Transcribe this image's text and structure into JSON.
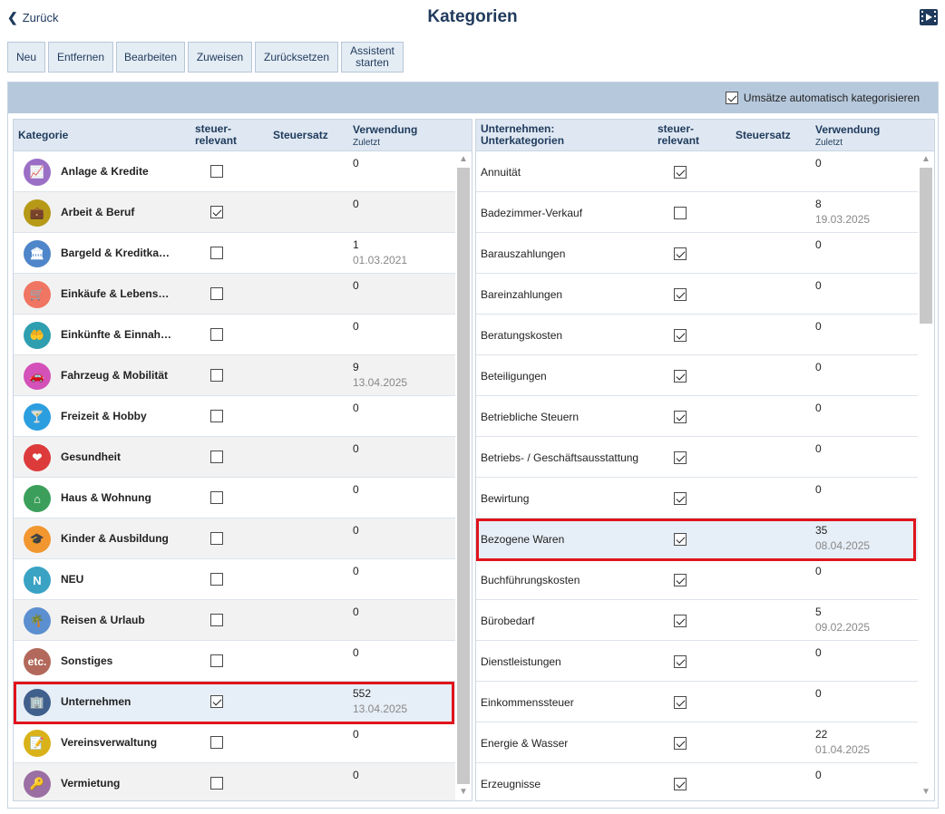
{
  "header": {
    "back_label": "Zurück",
    "title": "Kategorien"
  },
  "toolbar": {
    "new": "Neu",
    "remove": "Entfernen",
    "edit": "Bearbeiten",
    "assign": "Zuweisen",
    "reset": "Zurücksetzen",
    "wizard_1": "Assistent",
    "wizard_2": "starten"
  },
  "auto_categorize": {
    "label": "Umsätze automatisch kategorisieren",
    "checked": true
  },
  "left": {
    "col_category": "Kategorie",
    "col_tax_1": "steuer-",
    "col_tax_2": "relevant",
    "col_rate": "Steuersatz",
    "col_usage": "Verwendung",
    "col_last": "Zuletzt",
    "rows": [
      {
        "name": "Anlage & Kredite",
        "tax": false,
        "count": "0",
        "date": "",
        "icon": "chart-icon",
        "glyph": "📈",
        "color": "#9b6fc6"
      },
      {
        "name": "Arbeit & Beruf",
        "tax": true,
        "count": "0",
        "date": "",
        "icon": "briefcase-icon",
        "glyph": "💼",
        "color": "#b69a17"
      },
      {
        "name": "Bargeld & Kreditka…",
        "tax": false,
        "count": "1",
        "date": "01.03.2021",
        "icon": "bank-icon",
        "glyph": "🏛",
        "color": "#4f85c9"
      },
      {
        "name": "Einkäufe & Lebens…",
        "tax": false,
        "count": "0",
        "date": "",
        "icon": "cart-icon",
        "glyph": "🛒",
        "color": "#f07562"
      },
      {
        "name": "Einkünfte & Einnah…",
        "tax": false,
        "count": "0",
        "date": "",
        "icon": "income-icon",
        "glyph": "🤲",
        "color": "#2f9fb0"
      },
      {
        "name": "Fahrzeug & Mobilität",
        "tax": false,
        "count": "9",
        "date": "13.04.2025",
        "icon": "car-icon",
        "glyph": "🚗",
        "color": "#d351b8"
      },
      {
        "name": "Freizeit & Hobby",
        "tax": false,
        "count": "0",
        "date": "",
        "icon": "cocktail-icon",
        "glyph": "🍸",
        "color": "#2b9ee0"
      },
      {
        "name": "Gesundheit",
        "tax": false,
        "count": "0",
        "date": "",
        "icon": "heart-icon",
        "glyph": "❤",
        "color": "#dd3b3b"
      },
      {
        "name": "Haus & Wohnung",
        "tax": false,
        "count": "0",
        "date": "",
        "icon": "house-icon",
        "glyph": "⌂",
        "color": "#3b9f5b"
      },
      {
        "name": "Kinder & Ausbildung",
        "tax": false,
        "count": "0",
        "date": "",
        "icon": "graduation-cap-icon",
        "glyph": "🎓",
        "color": "#f2962f"
      },
      {
        "name": "NEU",
        "tax": false,
        "count": "0",
        "date": "",
        "icon": "new-icon",
        "glyph": "N",
        "color": "#3aa3c4"
      },
      {
        "name": "Reisen & Urlaub",
        "tax": false,
        "count": "0",
        "date": "",
        "icon": "palm-icon",
        "glyph": "🌴",
        "color": "#5b8fd0"
      },
      {
        "name": "Sonstiges",
        "tax": false,
        "count": "0",
        "date": "",
        "icon": "etc-icon",
        "glyph": "etc.",
        "color": "#b2685b"
      },
      {
        "name": "Unternehmen",
        "tax": true,
        "count": "552",
        "date": "13.04.2025",
        "icon": "building-icon",
        "glyph": "🏢",
        "color": "#3f5f8c"
      },
      {
        "name": "Vereinsverwaltung",
        "tax": false,
        "count": "0",
        "date": "",
        "icon": "clipboard-icon",
        "glyph": "📝",
        "color": "#d9b21a"
      },
      {
        "name": "Vermietung",
        "tax": false,
        "count": "0",
        "date": "",
        "icon": "key-icon",
        "glyph": "🔑",
        "color": "#9b6fa3"
      }
    ]
  },
  "right": {
    "col_category_1": "Unternehmen:",
    "col_category_2": "Unterkategorien",
    "col_tax_1": "steuer-",
    "col_tax_2": "relevant",
    "col_rate": "Steuersatz",
    "col_usage": "Verwendung",
    "col_last": "Zuletzt",
    "rows": [
      {
        "name": "Annuität",
        "tax": true,
        "count": "0",
        "date": ""
      },
      {
        "name": "Badezimmer-Verkauf",
        "tax": false,
        "count": "8",
        "date": "19.03.2025"
      },
      {
        "name": "Barauszahlungen",
        "tax": true,
        "count": "0",
        "date": ""
      },
      {
        "name": "Bareinzahlungen",
        "tax": true,
        "count": "0",
        "date": ""
      },
      {
        "name": "Beratungskosten",
        "tax": true,
        "count": "0",
        "date": ""
      },
      {
        "name": "Beteiligungen",
        "tax": true,
        "count": "0",
        "date": ""
      },
      {
        "name": "Betriebliche Steuern",
        "tax": true,
        "count": "0",
        "date": ""
      },
      {
        "name": "Betriebs- / Geschäftsausstattung",
        "tax": true,
        "count": "0",
        "date": ""
      },
      {
        "name": "Bewirtung",
        "tax": true,
        "count": "0",
        "date": ""
      },
      {
        "name": "Bezogene Waren",
        "tax": true,
        "count": "35",
        "date": "08.04.2025"
      },
      {
        "name": "Buchführungskosten",
        "tax": true,
        "count": "0",
        "date": ""
      },
      {
        "name": "Bürobedarf",
        "tax": true,
        "count": "5",
        "date": "09.02.2025"
      },
      {
        "name": "Dienstleistungen",
        "tax": true,
        "count": "0",
        "date": ""
      },
      {
        "name": "Einkommenssteuer",
        "tax": true,
        "count": "0",
        "date": ""
      },
      {
        "name": "Energie & Wasser",
        "tax": true,
        "count": "22",
        "date": "01.04.2025"
      },
      {
        "name": "Erzeugnisse",
        "tax": true,
        "count": "0",
        "date": ""
      }
    ]
  }
}
